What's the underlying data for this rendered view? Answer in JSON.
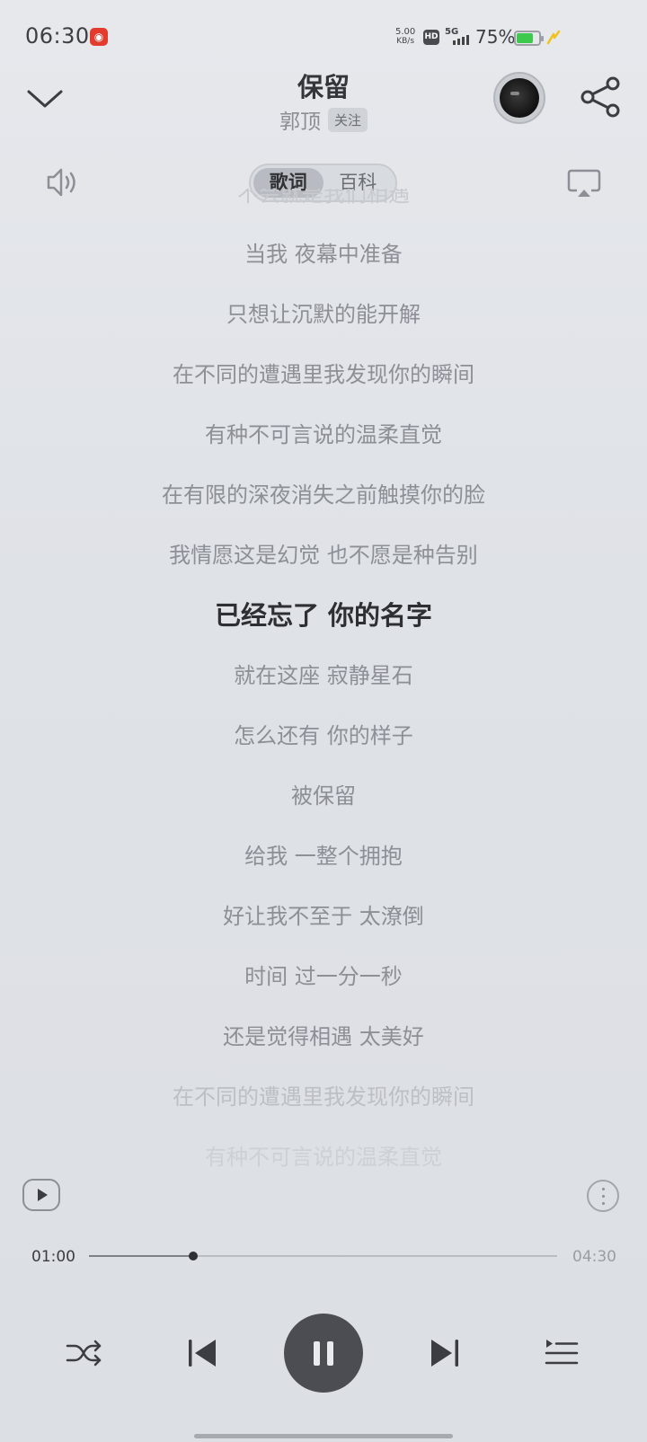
{
  "status_bar": {
    "time": "06:30",
    "app_icon": "netease-music-icon",
    "net_speed_value": "5.00",
    "net_speed_unit": "KB/s",
    "hd_label": "HD",
    "network_type": "5G",
    "battery_percent": "75%",
    "battery_level": 0.75,
    "battery_color": "#3cc94c",
    "charging_color": "#f1c21b"
  },
  "header": {
    "song_title": "保留",
    "artist": "郭顶",
    "follow_label": "关注"
  },
  "toolbar": {
    "tabs": [
      {
        "label": "歌词",
        "active": true
      },
      {
        "label": "百科",
        "active": false
      }
    ]
  },
  "lyrics": {
    "lines": [
      "不会就是我们相遇",
      "当我 夜幕中准备",
      "只想让沉默的能开解",
      "在不同的遭遇里我发现你的瞬间",
      "有种不可言说的温柔直觉",
      "在有限的深夜消失之前触摸你的脸",
      "我情愿这是幻觉 也不愿是种告别",
      "已经忘了 你的名字",
      "就在这座 寂静星石",
      "怎么还有 你的样子",
      "被保留",
      "给我 一整个拥抱",
      "好让我不至于 太潦倒",
      "时间 过一分一秒",
      "还是觉得相遇 太美好",
      "在不同的遭遇里我发现你的瞬间",
      "有种不可言说的温柔直觉"
    ],
    "current_index": 7
  },
  "player": {
    "elapsed": "01:00",
    "duration": "04:30",
    "progress": 0.222,
    "state": "playing"
  },
  "colors": {
    "background": "#e0e3e8",
    "current_lyric": "#2d2f33",
    "lyric": "#8c8f95",
    "play_button": "#4b4d52"
  }
}
